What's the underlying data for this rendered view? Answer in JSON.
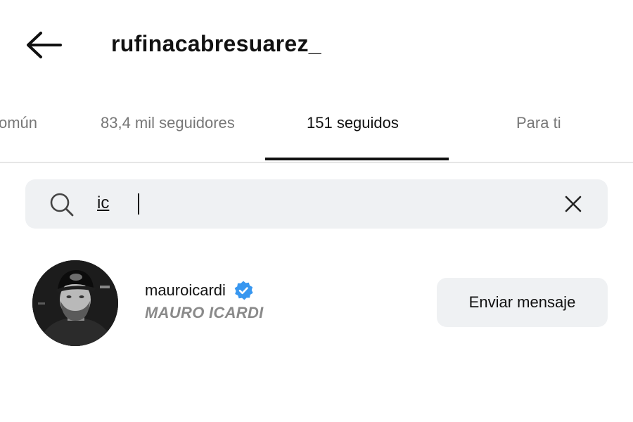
{
  "header": {
    "title": "rufinacabresuarez_"
  },
  "tabs": [
    {
      "label": "omún"
    },
    {
      "label": "83,4 mil seguidores"
    },
    {
      "label": "151 seguidos"
    },
    {
      "label": "Para ti"
    }
  ],
  "search": {
    "value": "ic"
  },
  "results": [
    {
      "username": "mauroicardi",
      "full_name": "MAURO ICARDI",
      "button_label": "Enviar mensaje"
    }
  ],
  "colors": {
    "verified_badge": "#3897f0",
    "muted_text": "#777777",
    "input_bg": "#eff1f3"
  }
}
